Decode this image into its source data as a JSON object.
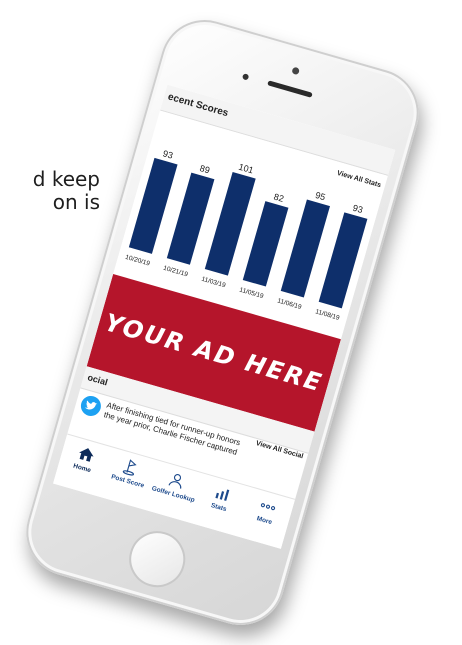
{
  "background_text": {
    "line1": "d keep",
    "line2": "on is"
  },
  "recent_scores": {
    "title": "ecent Scores",
    "view_all": "View All Stats",
    "bar_color": "#0e2f6b"
  },
  "chart_data": {
    "type": "bar",
    "categories": [
      "10/20/19",
      "10/21/19",
      "11/03/19",
      "11/05/19",
      "11/06/19",
      "11/08/19"
    ],
    "values": [
      93,
      89,
      101,
      82,
      95,
      93
    ],
    "ylim": [
      0,
      110
    ]
  },
  "ad": {
    "text": "YOUR AD HERE",
    "color": "#b5152b"
  },
  "social": {
    "title": "ocial",
    "view_all": "View All Social",
    "post_line1": "After finishing tied for runner-up honors",
    "post_line2": "the year prior, Charlie Fischer captured",
    "icon": "twitter-icon"
  },
  "tabbar": {
    "items": [
      {
        "label": "Home",
        "icon": "home-icon"
      },
      {
        "label": "Post Score",
        "icon": "golf-flag-icon"
      },
      {
        "label": "Golfer Lookup",
        "icon": "person-icon"
      },
      {
        "label": "Stats",
        "icon": "stats-icon"
      },
      {
        "label": "More",
        "icon": "more-icon"
      }
    ]
  }
}
